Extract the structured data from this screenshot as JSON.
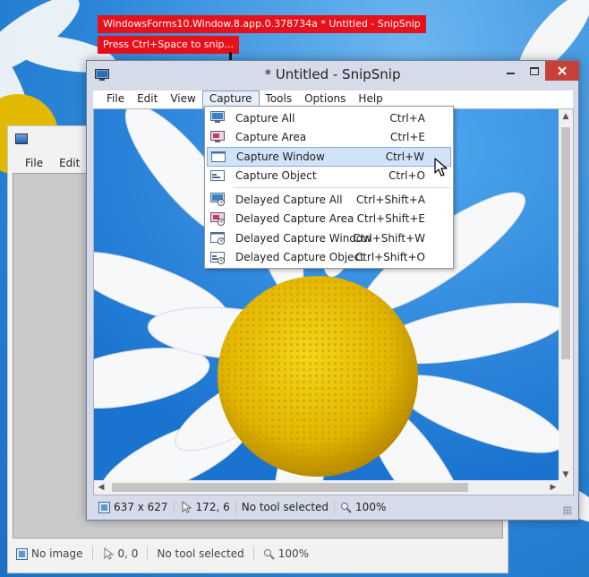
{
  "tooltips": {
    "window_handle": "WindowsForms10.Window.8.app.0.378734a * Untitled - SnipSnip",
    "hint": "Press Ctrl+Space to snip..."
  },
  "background_window": {
    "menu": [
      "File",
      "Edit"
    ],
    "status": {
      "image": "No image",
      "cursor": "0, 0",
      "tool": "No tool selected",
      "zoom": "100%"
    }
  },
  "window": {
    "title": "* Untitled - SnipSnip",
    "menu": [
      "File",
      "Edit",
      "View",
      "Capture",
      "Tools",
      "Options",
      "Help"
    ],
    "active_menu": "Capture",
    "status": {
      "size": "637 x 627",
      "cursor": "172, 6",
      "tool": "No tool selected",
      "zoom": "100%"
    }
  },
  "capture_menu": {
    "items": [
      {
        "label": "Capture All",
        "shortcut": "Ctrl+A",
        "icon": "monitor-icon"
      },
      {
        "label": "Capture Area",
        "shortcut": "Ctrl+E",
        "icon": "area-icon"
      },
      {
        "label": "Capture Window",
        "shortcut": "Ctrl+W",
        "icon": "window-icon",
        "highlighted": true
      },
      {
        "label": "Capture Object",
        "shortcut": "Ctrl+O",
        "icon": "object-icon"
      }
    ],
    "delayed_items": [
      {
        "label": "Delayed Capture All",
        "shortcut": "Ctrl+Shift+A",
        "icon": "delayed-monitor-icon"
      },
      {
        "label": "Delayed Capture Area",
        "shortcut": "Ctrl+Shift+E",
        "icon": "delayed-area-icon"
      },
      {
        "label": "Delayed Capture Window",
        "shortcut": "Ctrl+Shift+W",
        "icon": "delayed-window-icon"
      },
      {
        "label": "Delayed Capture Object",
        "shortcut": "Ctrl+Shift+O",
        "icon": "delayed-object-icon"
      }
    ]
  },
  "colors": {
    "tooltip": "#e8101a",
    "close_button": "#c7403a",
    "highlight": "#d1e4f7",
    "sky": "#2a8ee0",
    "daisy_center": "#e8c400"
  }
}
